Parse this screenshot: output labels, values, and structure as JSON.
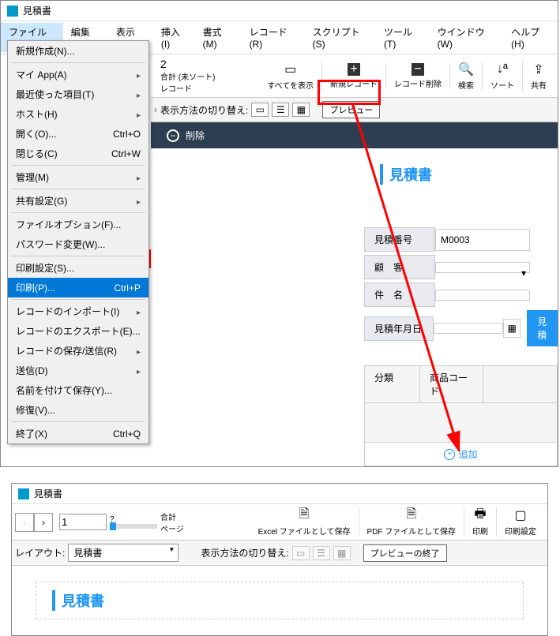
{
  "window1": {
    "title": "見積書",
    "menubar": [
      "ファイル(F)",
      "編集(E)",
      "表示(V)",
      "挿入(I)",
      "書式(M)",
      "レコード(R)",
      "スクリプト(S)",
      "ツール(T)",
      "ウインドウ(W)",
      "ヘルプ(H)"
    ],
    "fileMenu": [
      {
        "label": "新規作成(N)...",
        "shortcut": ""
      },
      {
        "sep": true
      },
      {
        "label": "マイ App(A)",
        "sub": true
      },
      {
        "label": "最近使った項目(T)",
        "sub": true
      },
      {
        "label": "ホスト(H)",
        "sub": true
      },
      {
        "label": "開く(O)...",
        "shortcut": "Ctrl+O"
      },
      {
        "label": "閉じる(C)",
        "shortcut": "Ctrl+W"
      },
      {
        "sep": true
      },
      {
        "label": "管理(M)",
        "sub": true
      },
      {
        "sep": true
      },
      {
        "label": "共有設定(G)",
        "sub": true
      },
      {
        "sep": true
      },
      {
        "label": "ファイルオプション(F)...",
        "shortcut": ""
      },
      {
        "label": "パスワード変更(W)...",
        "shortcut": ""
      },
      {
        "sep": true
      },
      {
        "label": "印刷設定(S)...",
        "shortcut": ""
      },
      {
        "label": "印刷(P)...",
        "shortcut": "Ctrl+P",
        "selected": true
      },
      {
        "sep": true
      },
      {
        "label": "レコードのインポート(I)",
        "sub": true
      },
      {
        "label": "レコードのエクスポート(E)...",
        "shortcut": ""
      },
      {
        "label": "レコードの保存/送信(R)",
        "sub": true
      },
      {
        "label": "送信(D)",
        "sub": true
      },
      {
        "label": "名前を付けて保存(Y)...",
        "shortcut": ""
      },
      {
        "label": "修復(V)...",
        "shortcut": ""
      },
      {
        "sep": true
      },
      {
        "label": "終了(X)",
        "shortcut": "Ctrl+Q"
      }
    ],
    "recordNav": {
      "count": "2",
      "status": "合計 (未ソート)",
      "label": "レコード"
    },
    "toolbar": {
      "showAll": "すべてを表示",
      "newRecord": "新規レコード",
      "deleteRecord": "レコード削除",
      "search": "検索",
      "sort": "ソート",
      "share": "共有"
    },
    "layoutBar": {
      "switchLabel": "表示方法の切り替え:",
      "preview": "プレビュー"
    },
    "deleteLabel": "削除",
    "sectionTitle": "見積書",
    "fields": {
      "estimateNo": {
        "label": "見積番号",
        "value": "M0003"
      },
      "customer": {
        "label": "顧　客"
      },
      "subject": {
        "label": "件　名"
      },
      "date": {
        "label": "見積年月日"
      },
      "dateExtra": "見積"
    },
    "tableHeaders": [
      "分類",
      "商品コード"
    ],
    "addLabel": "追加"
  },
  "window2": {
    "title": "見積書",
    "page": "1",
    "totalLabel": "合計",
    "pageLabel": "ページ",
    "unknown": "?",
    "toolbar": {
      "excel": "Excel ファイルとして保存",
      "pdf": "PDF ファイルとして保存",
      "print": "印刷",
      "printSettings": "印刷設定"
    },
    "layoutLabel": "レイアウト:",
    "layoutValue": "見積書",
    "switchLabel": "表示方法の切り替え:",
    "endPreview": "プレビューの終了",
    "sectionTitle": "見積書"
  }
}
